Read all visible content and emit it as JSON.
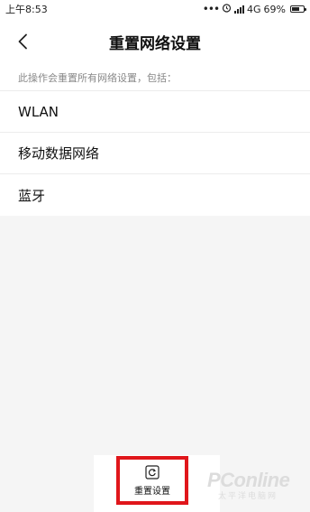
{
  "status_bar": {
    "time": "上午8:53",
    "dots": "•••",
    "network": "4G",
    "battery_text": "69%",
    "battery_level": 0.69
  },
  "header": {
    "title": "重置网络设置"
  },
  "description": "此操作会重置所有网络设置，包括：",
  "items": [
    {
      "label": "WLAN"
    },
    {
      "label": "移动数据网络"
    },
    {
      "label": "蓝牙"
    }
  ],
  "footer": {
    "reset_label": "重置设置"
  },
  "watermark": {
    "main": "PConline",
    "sub": "太平洋电脑网"
  },
  "colors": {
    "highlight_border": "#e0161b",
    "background": "#f5f5f5"
  }
}
